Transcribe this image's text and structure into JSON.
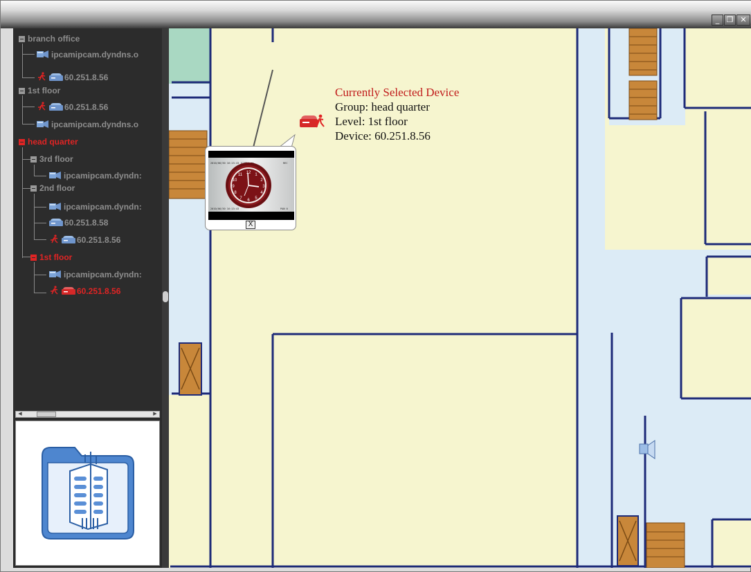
{
  "window": {
    "buttons": {
      "minimize": "_",
      "restore": "❐",
      "close": "✕"
    }
  },
  "tree": {
    "groups": [
      {
        "label": "branch office",
        "children": [
          {
            "type": "camera",
            "label": "ipcamipcam.dyndns.o"
          },
          {
            "type": "dvr",
            "alarm": true,
            "label": "60.251.8.56"
          }
        ]
      },
      {
        "label": "1st floor",
        "children": [
          {
            "type": "dvr",
            "alarm": true,
            "label": "60.251.8.56"
          },
          {
            "type": "camera",
            "label": "ipcamipcam.dyndns.o"
          }
        ]
      },
      {
        "label": "head quarter",
        "selected": true,
        "levels": [
          {
            "label": "3rd floor",
            "children": [
              {
                "type": "camera",
                "label": "ipcamipcam.dyndn:"
              }
            ]
          },
          {
            "label": "2nd floor",
            "children": [
              {
                "type": "camera",
                "label": "ipcamipcam.dyndn:"
              },
              {
                "type": "dvr",
                "label": "60.251.8.58"
              },
              {
                "type": "dvr",
                "alarm": true,
                "label": "60.251.8.56"
              }
            ]
          },
          {
            "label": "1st floor",
            "selected": true,
            "children": [
              {
                "type": "camera",
                "label": "ipcamipcam.dyndn:"
              },
              {
                "type": "dvr",
                "alarm": true,
                "selected": true,
                "label": "60.251.8.56"
              }
            ]
          }
        ]
      }
    ]
  },
  "popup": {
    "title": "Currently Selected Device",
    "group": "Group: head quarter",
    "level": "Level: 1st floor",
    "device": "Device: 60.251.8.56",
    "video_overlay_top": "2010/06/30 16:13:43 [CAM1] ■□",
    "video_overlay_top_right": "REC",
    "video_overlay_bottom": "2010/06/30 16:13:43",
    "video_overlay_bottom_right": "PAN 0",
    "close_label": "X"
  },
  "colors": {
    "selected": "#e02424",
    "tree_text": "#8e8e8e",
    "map_room": "#f6f5cf",
    "map_corridor": "#dcebf6",
    "wall": "#1d2a78",
    "stairs": "#c8873a"
  }
}
